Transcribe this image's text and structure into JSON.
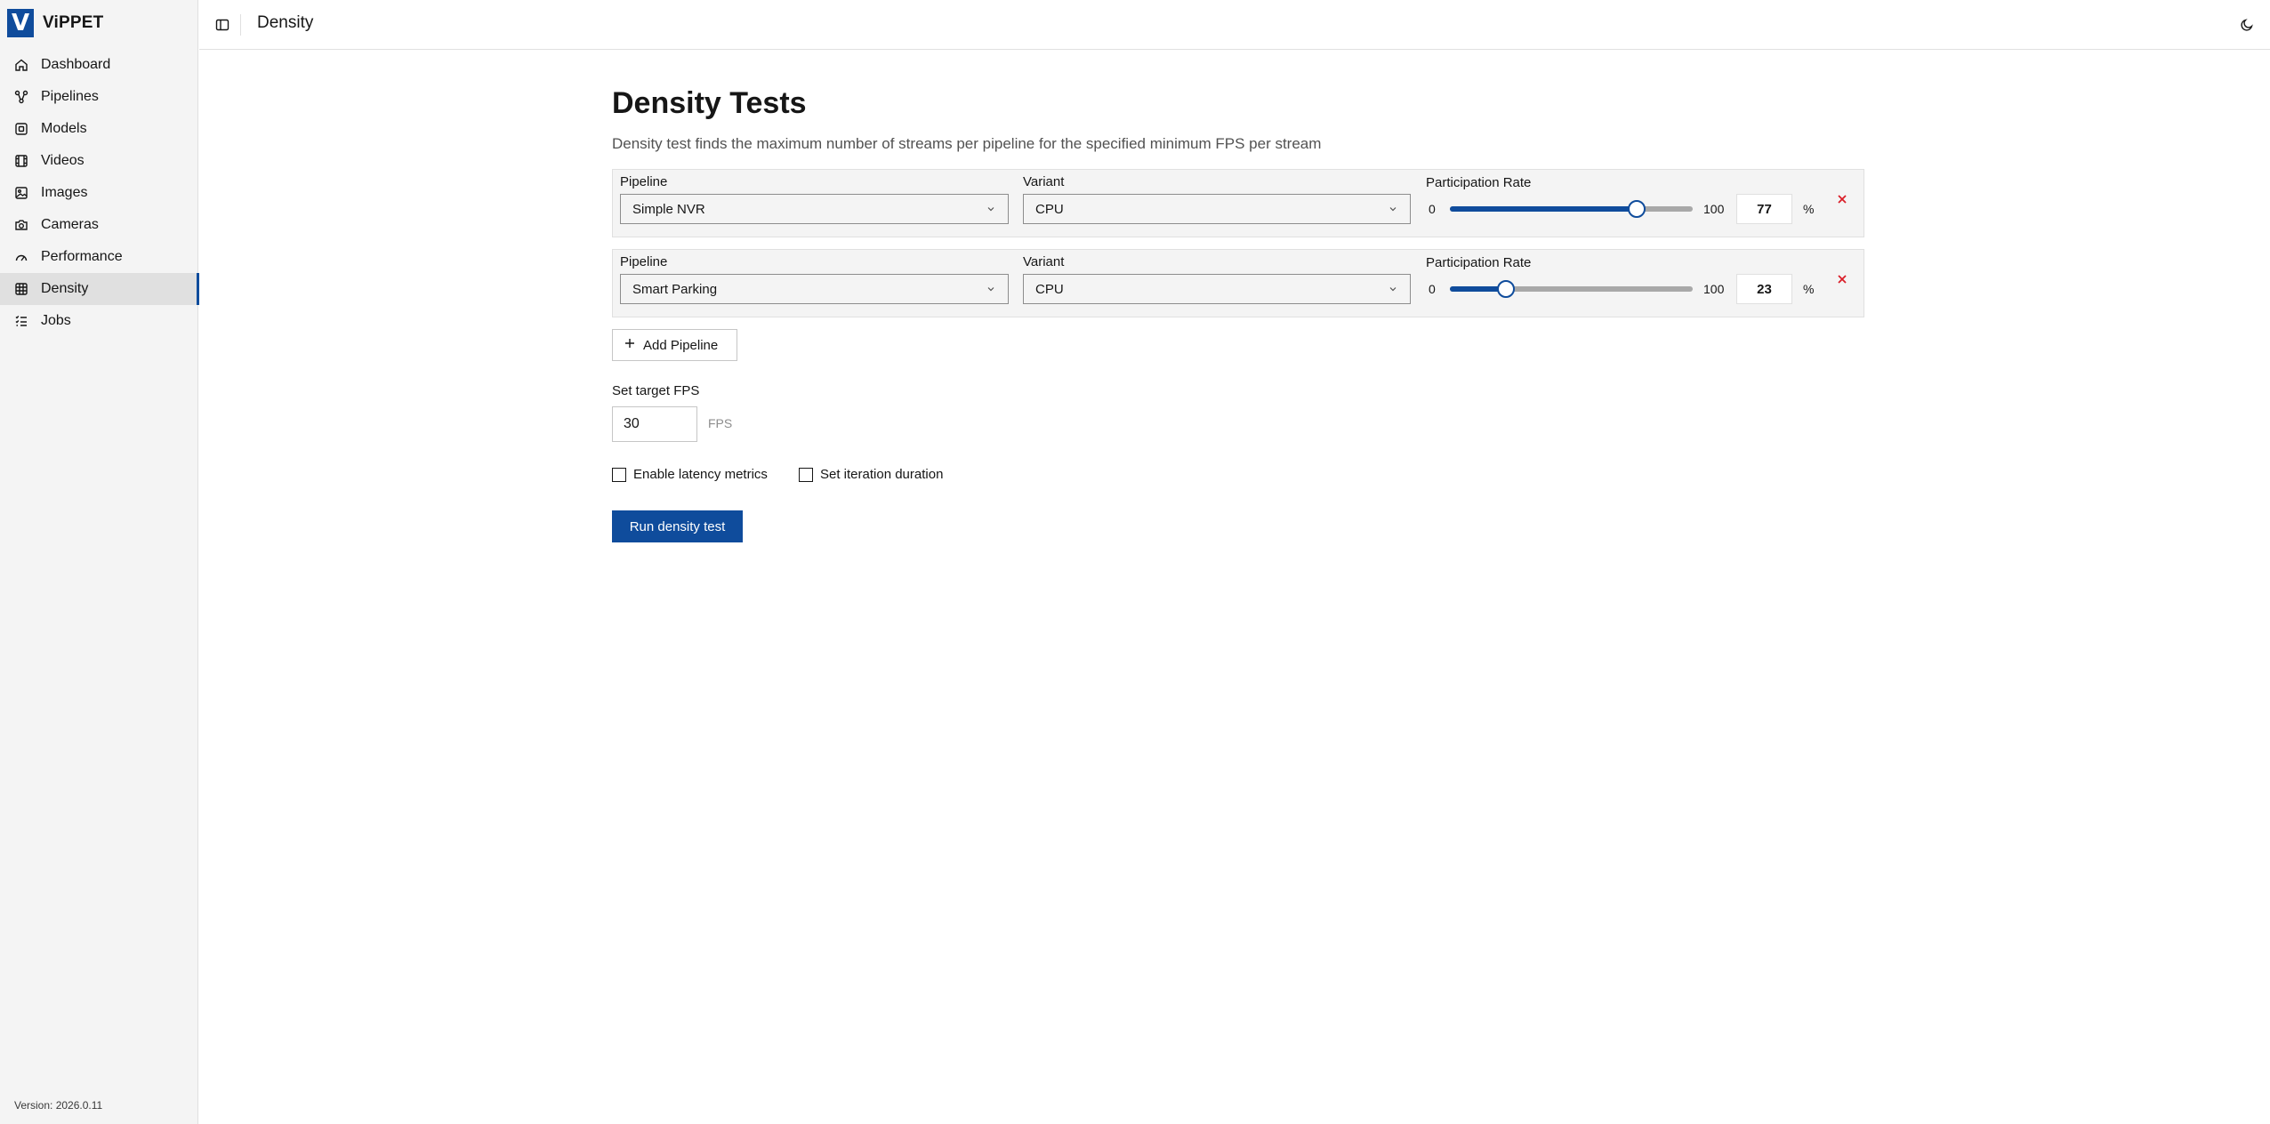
{
  "app": {
    "logo_letter": "V",
    "name": "ViPPET",
    "version": "Version: 2026.0.11"
  },
  "header": {
    "title": "Density"
  },
  "sidebar": {
    "items": [
      {
        "label": "Dashboard",
        "icon": "home-icon"
      },
      {
        "label": "Pipelines",
        "icon": "pipeline-icon"
      },
      {
        "label": "Models",
        "icon": "chip-icon"
      },
      {
        "label": "Videos",
        "icon": "film-icon"
      },
      {
        "label": "Images",
        "icon": "image-icon"
      },
      {
        "label": "Cameras",
        "icon": "camera-icon"
      },
      {
        "label": "Performance",
        "icon": "gauge-icon"
      },
      {
        "label": "Density",
        "icon": "grid-icon",
        "active": true
      },
      {
        "label": "Jobs",
        "icon": "list-icon"
      }
    ]
  },
  "main": {
    "title": "Density Tests",
    "description": "Density test finds the maximum number of streams per pipeline for the specified minimum FPS per stream",
    "pipelines": [
      {
        "pipeline_label": "Pipeline",
        "pipeline_value": "Simple NVR",
        "variant_label": "Variant",
        "variant_value": "CPU",
        "rate_label": "Participation Rate",
        "rate_min": "0",
        "rate_max": "100",
        "rate_value": "77",
        "rate_unit": "%"
      },
      {
        "pipeline_label": "Pipeline",
        "pipeline_value": "Smart Parking",
        "variant_label": "Variant",
        "variant_value": "CPU",
        "rate_label": "Participation Rate",
        "rate_min": "0",
        "rate_max": "100",
        "rate_value": "23",
        "rate_unit": "%"
      }
    ],
    "add_pipeline_label": "Add Pipeline",
    "target_fps_label": "Set target FPS",
    "target_fps_value": "30",
    "target_fps_unit": "FPS",
    "latency_label": "Enable latency metrics",
    "latency_checked": false,
    "iteration_label": "Set iteration duration",
    "iteration_checked": false,
    "run_label": "Run density test"
  },
  "colors": {
    "accent": "#0f4c9c",
    "remove": "#da1e28"
  }
}
